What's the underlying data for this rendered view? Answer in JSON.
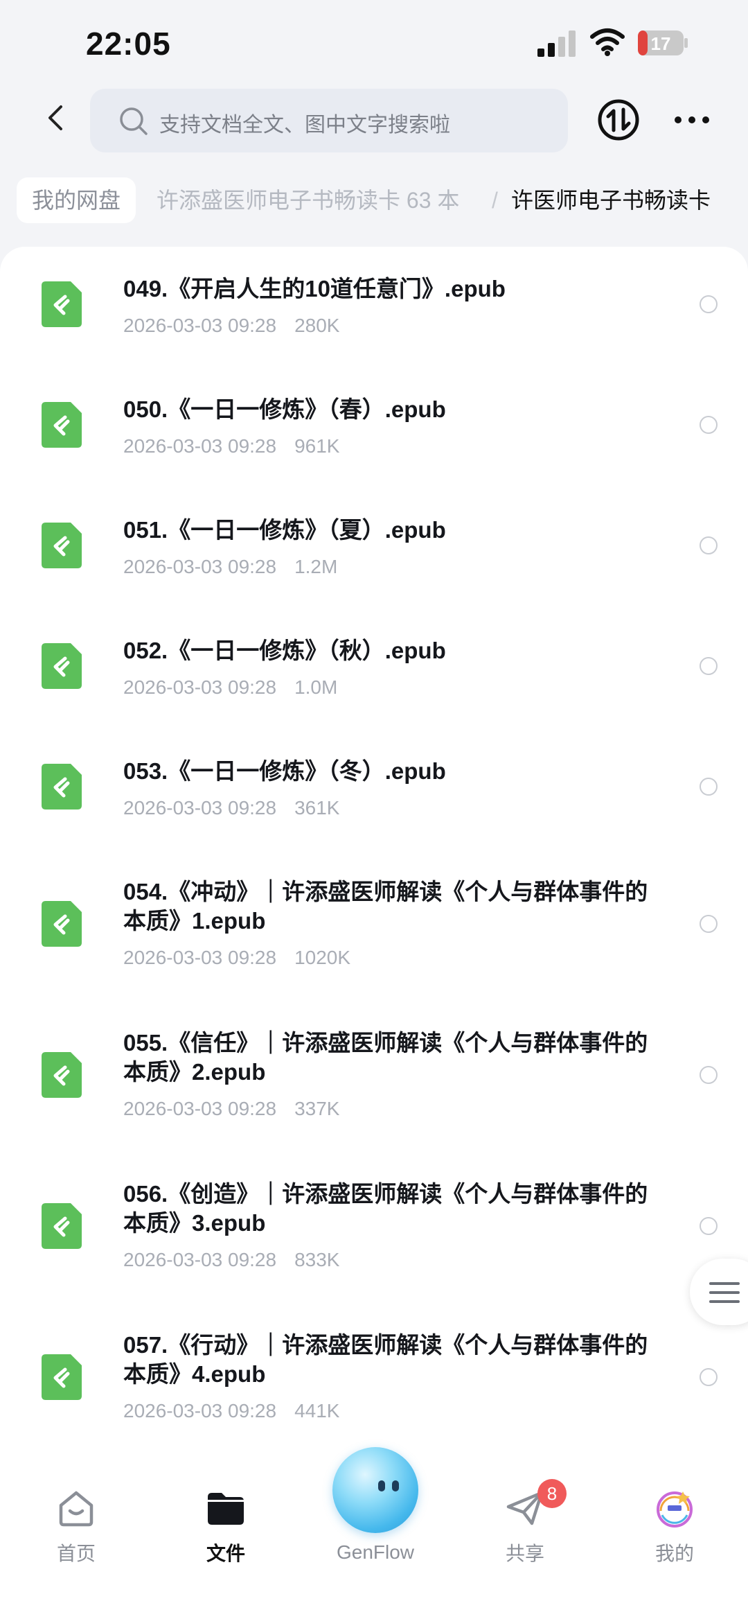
{
  "status_bar": {
    "time": "22:05",
    "battery": "17"
  },
  "search": {
    "placeholder": "支持文档全文、图中文字搜索啦"
  },
  "breadcrumb": {
    "root": "我的网盘",
    "middle": "许添盛医师电子书畅读卡 63 本",
    "separator": "/",
    "current": "许医师电子书畅读卡"
  },
  "files": [
    {
      "name": "049.《开启人生的10道任意门》.epub",
      "date": "2026-03-03 09:28",
      "size": "280K"
    },
    {
      "name": "050.《一日一修炼》（春）.epub",
      "date": "2026-03-03 09:28",
      "size": "961K"
    },
    {
      "name": "051.《一日一修炼》（夏）.epub",
      "date": "2026-03-03 09:28",
      "size": "1.2M"
    },
    {
      "name": "052.《一日一修炼》（秋）.epub",
      "date": "2026-03-03 09:28",
      "size": "1.0M"
    },
    {
      "name": "053.《一日一修炼》（冬）.epub",
      "date": "2026-03-03 09:28",
      "size": "361K"
    },
    {
      "name": "054.《冲动》｜许添盛医师解读《个人与群体事件的本质》1.epub",
      "date": "2026-03-03 09:28",
      "size": "1020K"
    },
    {
      "name": "055.《信任》｜许添盛医师解读《个人与群体事件的本质》2.epub",
      "date": "2026-03-03 09:28",
      "size": "337K"
    },
    {
      "name": "056.《创造》｜许添盛医师解读《个人与群体事件的本质》3.epub",
      "date": "2026-03-03 09:28",
      "size": "833K"
    },
    {
      "name": "057.《行动》｜许添盛医师解读《个人与群体事件的本质》4.epub",
      "date": "2026-03-03 09:28",
      "size": "441K"
    }
  ],
  "nav": {
    "home": "首页",
    "files": "文件",
    "genflow": "GenFlow",
    "share": "共享",
    "share_badge": "8",
    "mine": "我的"
  },
  "colors": {
    "accent_green": "#5cbf5a",
    "badge_red": "#f05a5a",
    "active_nav": "#111111"
  }
}
